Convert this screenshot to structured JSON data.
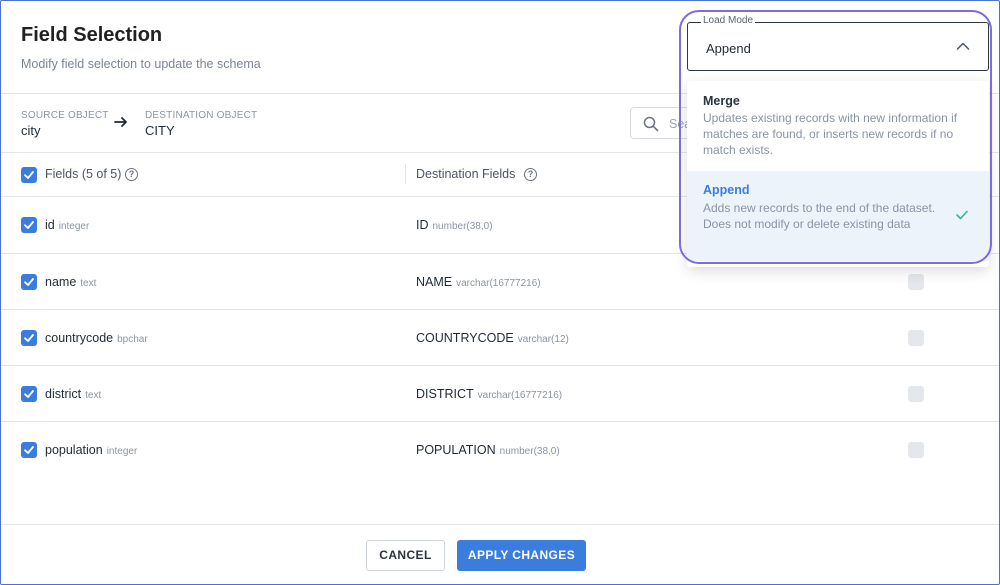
{
  "header": {
    "title": "Field Selection",
    "subtitle": "Modify field selection to update the schema"
  },
  "objects": {
    "source_label": "SOURCE OBJECT",
    "source_value": "city",
    "destination_label": "DESTINATION OBJECT",
    "destination_value": "CITY"
  },
  "search": {
    "placeholder": "Sea"
  },
  "table": {
    "fields_header": "Fields (5 of 5)",
    "destination_header": "Destination Fields",
    "rows": [
      {
        "name": "id",
        "type": "integer",
        "dest_name": "ID",
        "dest_type": "number(38,0)",
        "checked": true
      },
      {
        "name": "name",
        "type": "text",
        "dest_name": "NAME",
        "dest_type": "varchar(16777216)",
        "checked": true
      },
      {
        "name": "countrycode",
        "type": "bpchar",
        "dest_name": "COUNTRYCODE",
        "dest_type": "varchar(12)",
        "checked": true
      },
      {
        "name": "district",
        "type": "text",
        "dest_name": "DISTRICT",
        "dest_type": "varchar(16777216)",
        "checked": true
      },
      {
        "name": "population",
        "type": "integer",
        "dest_name": "POPULATION",
        "dest_type": "number(38,0)",
        "checked": true
      }
    ]
  },
  "load_mode": {
    "label": "Load Mode",
    "selected": "Append",
    "options": [
      {
        "title": "Merge",
        "description": "Updates existing records with new information if matches are found, or inserts new records if no match exists."
      },
      {
        "title": "Append",
        "description": "Adds new records to the end of the dataset. Does not modify or delete existing data"
      }
    ]
  },
  "footer": {
    "cancel_label": "CANCEL",
    "apply_label": "APPLY CHANGES"
  },
  "colors": {
    "accent": "#3b7ddd",
    "highlight": "#7b6ce0",
    "check": "#3bb28a"
  },
  "icons": {
    "arrow": "arrow-right-icon",
    "search": "search-icon",
    "help": "help-circle-icon",
    "check": "checkmark-icon",
    "chevron": "chevron-up-icon"
  }
}
